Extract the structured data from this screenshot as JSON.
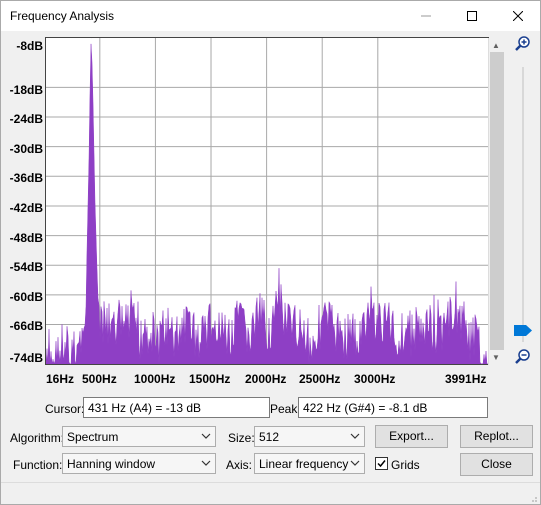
{
  "window": {
    "title": "Frequency Analysis"
  },
  "plot": {
    "y_labels": [
      "-8dB",
      "-18dB",
      "-24dB",
      "-30dB",
      "-36dB",
      "-42dB",
      "-48dB",
      "-54dB",
      "-60dB",
      "-66dB",
      "-74dB"
    ],
    "x_labels": [
      "16Hz",
      "500Hz",
      "1000Hz",
      "1500Hz",
      "2000Hz",
      "2500Hz",
      "3000Hz",
      "3991Hz"
    ],
    "fill_color": "#8e3fc5",
    "grid_color": "#a8a8a8"
  },
  "chart_data": {
    "type": "area",
    "xlabel": "",
    "ylabel": "",
    "xlim": [
      16,
      3991
    ],
    "ylim": [
      -74,
      -8
    ],
    "x_ticks": [
      "16Hz",
      "500Hz",
      "1000Hz",
      "1500Hz",
      "2000Hz",
      "2500Hz",
      "3000Hz",
      "3991Hz"
    ],
    "y_ticks": [
      "-8dB",
      "-18dB",
      "-24dB",
      "-30dB",
      "-36dB",
      "-42dB",
      "-48dB",
      "-54dB",
      "-60dB",
      "-66dB",
      "-74dB"
    ],
    "grid": true,
    "peak": {
      "frequency_hz": 422,
      "level_db": -8.1
    },
    "series": [
      {
        "x": [
          16,
          80,
          150,
          220,
          290,
          340,
          380,
          405,
          415,
          422,
          430,
          440,
          455,
          475,
          500,
          530,
          570,
          620,
          680,
          740,
          800,
          860,
          920,
          980,
          1040,
          1100,
          1150,
          1200,
          1260,
          1320,
          1380,
          1440,
          1500,
          1560,
          1620,
          1680,
          1740,
          1800,
          1860,
          1920,
          1980,
          2040,
          2100,
          2160,
          2220,
          2280,
          2340,
          2400,
          2460,
          2520,
          2580,
          2640,
          2700,
          2760,
          2820,
          2880,
          2940,
          3000,
          3060,
          3120,
          3180,
          3240,
          3300,
          3360,
          3420,
          3480,
          3540,
          3600,
          3660,
          3720,
          3780,
          3840,
          3900,
          3960,
          3991
        ],
        "values": [
          -70,
          -68,
          -67,
          -69,
          -66,
          -64,
          -56,
          -30,
          -14,
          -8.1,
          -13,
          -22,
          -40,
          -55,
          -62,
          -64,
          -61,
          -63,
          -60,
          -62,
          -61,
          -64,
          -62,
          -63,
          -65,
          -61,
          -64,
          -63,
          -62,
          -60,
          -65,
          -63,
          -61,
          -64,
          -62,
          -66,
          -60,
          -62,
          -64,
          -59,
          -61,
          -62,
          -57,
          -60,
          -63,
          -61,
          -63,
          -66,
          -62,
          -60,
          -61,
          -63,
          -64,
          -62,
          -65,
          -62,
          -59,
          -60,
          -62,
          -61,
          -64,
          -62,
          -63,
          -61,
          -64,
          -62,
          -63,
          -61,
          -60,
          -59,
          -62,
          -64,
          -66,
          -68,
          -70
        ]
      }
    ]
  },
  "scrollbar": {
    "up": "▲",
    "down": "▼"
  },
  "cursor": {
    "label": "Cursor:",
    "value": "431 Hz (A4) = -13 dB"
  },
  "peak": {
    "label": "Peak:",
    "value": "422 Hz (G#4) = -8.1 dB"
  },
  "algorithm": {
    "label": "Algorithm:",
    "value": "Spectrum"
  },
  "size": {
    "label": "Size:",
    "value": "512"
  },
  "function": {
    "label": "Function:",
    "value": "Hanning window"
  },
  "axis": {
    "label": "Axis:",
    "value": "Linear frequency"
  },
  "grids": {
    "label": "Grids",
    "checked": true
  },
  "buttons": {
    "export": "Export...",
    "replot": "Replot...",
    "close": "Close"
  },
  "icons": {
    "zoom_in": "zoom-in-icon",
    "zoom_out": "zoom-out-icon"
  },
  "accent": "#0078d7"
}
